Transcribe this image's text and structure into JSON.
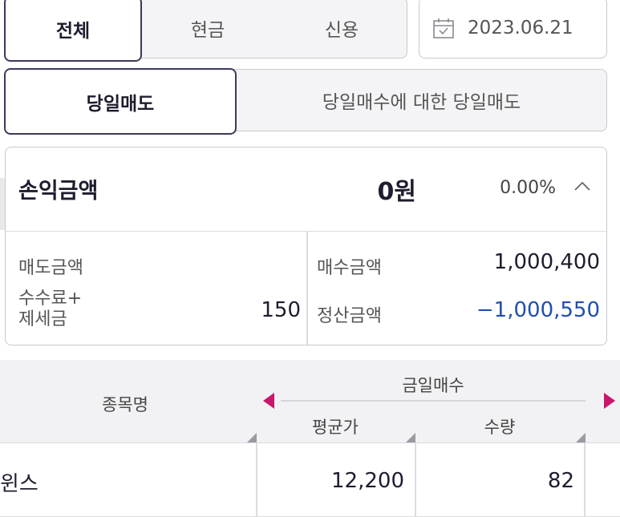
{
  "account_tabs": [
    "전체",
    "현금",
    "신용"
  ],
  "date": "2023.06.21",
  "trade_tabs": [
    "당일매도",
    "당일매수에 대한 당일매도"
  ],
  "summary": {
    "profit_label": "손익금액",
    "profit_amount": "0원",
    "profit_rate": "0.00%",
    "sell_amount_label": "매도금액",
    "sell_amount_value": "",
    "fee_tax_label_1": "수수료+",
    "fee_tax_label_2": "제세금",
    "fee_tax_value": "150",
    "buy_amount_label": "매수금액",
    "buy_amount_value": "1,000,400",
    "settle_label": "정산금액",
    "settle_value": "−1,000,550"
  },
  "table": {
    "col_name": "종목명",
    "group_header": "금일매수",
    "col_avg_price": "평균가",
    "col_qty": "수량",
    "rows": [
      {
        "name": "윈스",
        "avg_price": "12,200",
        "qty": "82"
      }
    ]
  },
  "colors": {
    "accent_border": "#3a3b5c",
    "negative": "#1f4fb0",
    "arrow": "#c8176e"
  },
  "icons": [
    "calendar-icon",
    "chevron-up-icon",
    "arrow-left-icon",
    "arrow-right-icon"
  ]
}
